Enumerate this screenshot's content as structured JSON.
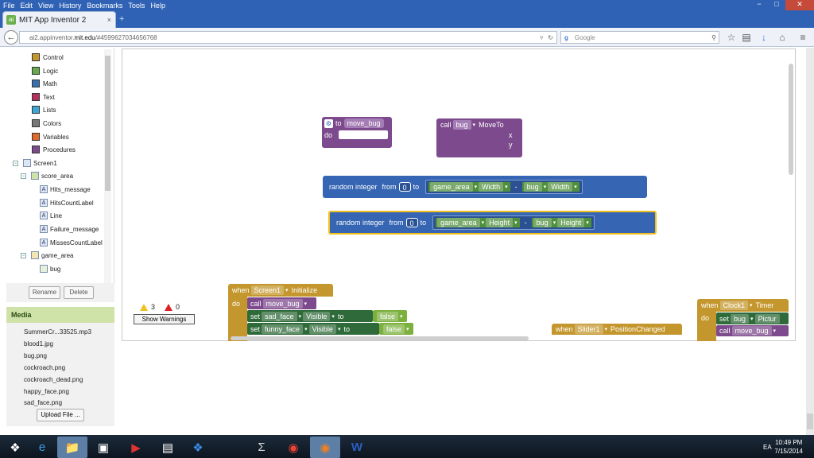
{
  "menu": [
    "File",
    "Edit",
    "View",
    "History",
    "Bookmarks",
    "Tools",
    "Help"
  ],
  "window_controls": {
    "min": "−",
    "max": "□",
    "close": "✕"
  },
  "tab": {
    "title": "MIT App Inventor 2",
    "close": "×",
    "favicon": "ai"
  },
  "new_tab": "+",
  "url": {
    "prefix": "ai2.appinventor.",
    "host": "mit.edu",
    "path": "/#4599627034656768"
  },
  "search": {
    "engine": "g",
    "placeholder": "Google"
  },
  "blocks_tree": {
    "builtins": [
      {
        "label": "Control",
        "color": "#c4972e"
      },
      {
        "label": "Logic",
        "color": "#6aa84f"
      },
      {
        "label": "Math",
        "color": "#3a6fb0"
      },
      {
        "label": "Text",
        "color": "#b5305a"
      },
      {
        "label": "Lists",
        "color": "#3ea6d3"
      },
      {
        "label": "Colors",
        "color": "#777777"
      },
      {
        "label": "Variables",
        "color": "#e06a2a"
      },
      {
        "label": "Procedures",
        "color": "#7d4b8d"
      }
    ],
    "screen": "Screen1",
    "score_area": "score_area",
    "score_children": [
      "Hits_message",
      "HitsCountLabel",
      "Line",
      "Failure_message",
      "MissesCountLabel"
    ],
    "game_area": "game_area",
    "game_children": [
      "bug"
    ],
    "toggle_minus": "⊟",
    "rename": "Rename",
    "delete": "Delete"
  },
  "media": {
    "header": "Media",
    "files": [
      "SummerCr...33525.mp3",
      "blood1.jpg",
      "bug.png",
      "cockroach.png",
      "cockroach_dead.png",
      "happy_face.png",
      "sad_face.png"
    ],
    "upload": "Upload File ..."
  },
  "workspace": {
    "proc_def": {
      "to": "to",
      "name": "move_bug",
      "do": "do"
    },
    "call_moveto": {
      "call": "call",
      "component": "bug",
      "method": "MoveTo",
      "x": "x",
      "y": "y"
    },
    "rand1": {
      "label": "random integer",
      "from": "from",
      "from_val": "0",
      "to": "to",
      "comp1": "game_area",
      "prop1": "Width",
      "minus": "-",
      "comp2": "bug",
      "prop2": "Width"
    },
    "rand2": {
      "label": "random integer",
      "from": "from",
      "from_val": "0",
      "to": "to",
      "comp1": "game_area",
      "prop1": "Height",
      "minus": "-",
      "comp2": "bug",
      "prop2": "Height"
    },
    "when_init": {
      "when": "when",
      "component": "Screen1",
      "event": "Initialize",
      "do": "do",
      "call": "call",
      "call_name": "move_bug",
      "set1": {
        "set": "set",
        "comp": "sad_face",
        "prop": "Visible",
        "to": "to",
        "val": "false"
      },
      "set2": {
        "set": "set",
        "comp": "funny_face",
        "prop": "Visible",
        "to": "to",
        "val": "false"
      }
    },
    "when_slider": {
      "when": "when",
      "component": "Slider1",
      "event": "PositionChanged"
    },
    "when_clock": {
      "when": "when",
      "component": "Clock1",
      "event": "Timer",
      "do": "do",
      "set": "set",
      "set_comp": "bug",
      "set_prop": "Pictur",
      "call": "call",
      "call_name": "move_bug"
    },
    "warnings_count": "3",
    "errors_count": "0",
    "show_warnings": "Show Warnings"
  },
  "taskbar": {
    "time": "10:49 PM",
    "date": "7/15/2014",
    "lang": "EA"
  }
}
